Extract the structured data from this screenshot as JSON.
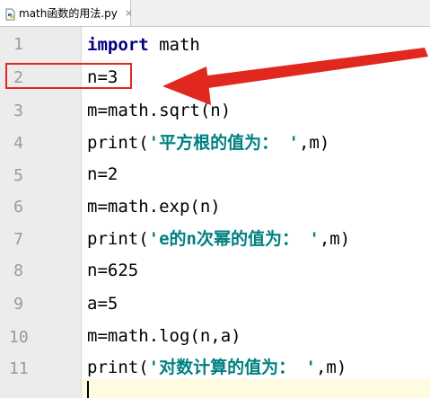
{
  "tab": {
    "filename": "math函数的用法.py",
    "close_glyph": "×",
    "icon": "python-file-icon"
  },
  "lines": [
    {
      "num": "1",
      "text": "import math"
    },
    {
      "num": "2",
      "text": "n=3"
    },
    {
      "num": "3",
      "text": "m=math.sqrt(n)"
    },
    {
      "num": "4",
      "text": "print('平方根的值为： ',m)"
    },
    {
      "num": "5",
      "text": "n=2"
    },
    {
      "num": "6",
      "text": "m=math.exp(n)"
    },
    {
      "num": "7",
      "text": "print('e的n次幂的值为： ',m)"
    },
    {
      "num": "8",
      "text": "n=625"
    },
    {
      "num": "9",
      "text": "a=5"
    },
    {
      "num": "10",
      "text": "m=math.log(n,a)"
    },
    {
      "num": "11",
      "text": "print('对数计算的值为： ',m)"
    }
  ],
  "parts": {
    "l1_kw": "import",
    "l1_rest": " math",
    "l4_fn": "print(",
    "l4_str": "'平方根的值为： '",
    "l4_tail": ",m)",
    "l7_fn": "print(",
    "l7_str": "'e的n次幂的值为： '",
    "l7_tail": ",m)",
    "l11_fn": "print(",
    "l11_str": "'对数计算的值为： '",
    "l11_tail": ",m)"
  },
  "colors": {
    "keyword": "#000080",
    "string": "#008080",
    "annotation": "#e0281f",
    "gutter": "#ececec",
    "current_line": "#fffbe0"
  }
}
